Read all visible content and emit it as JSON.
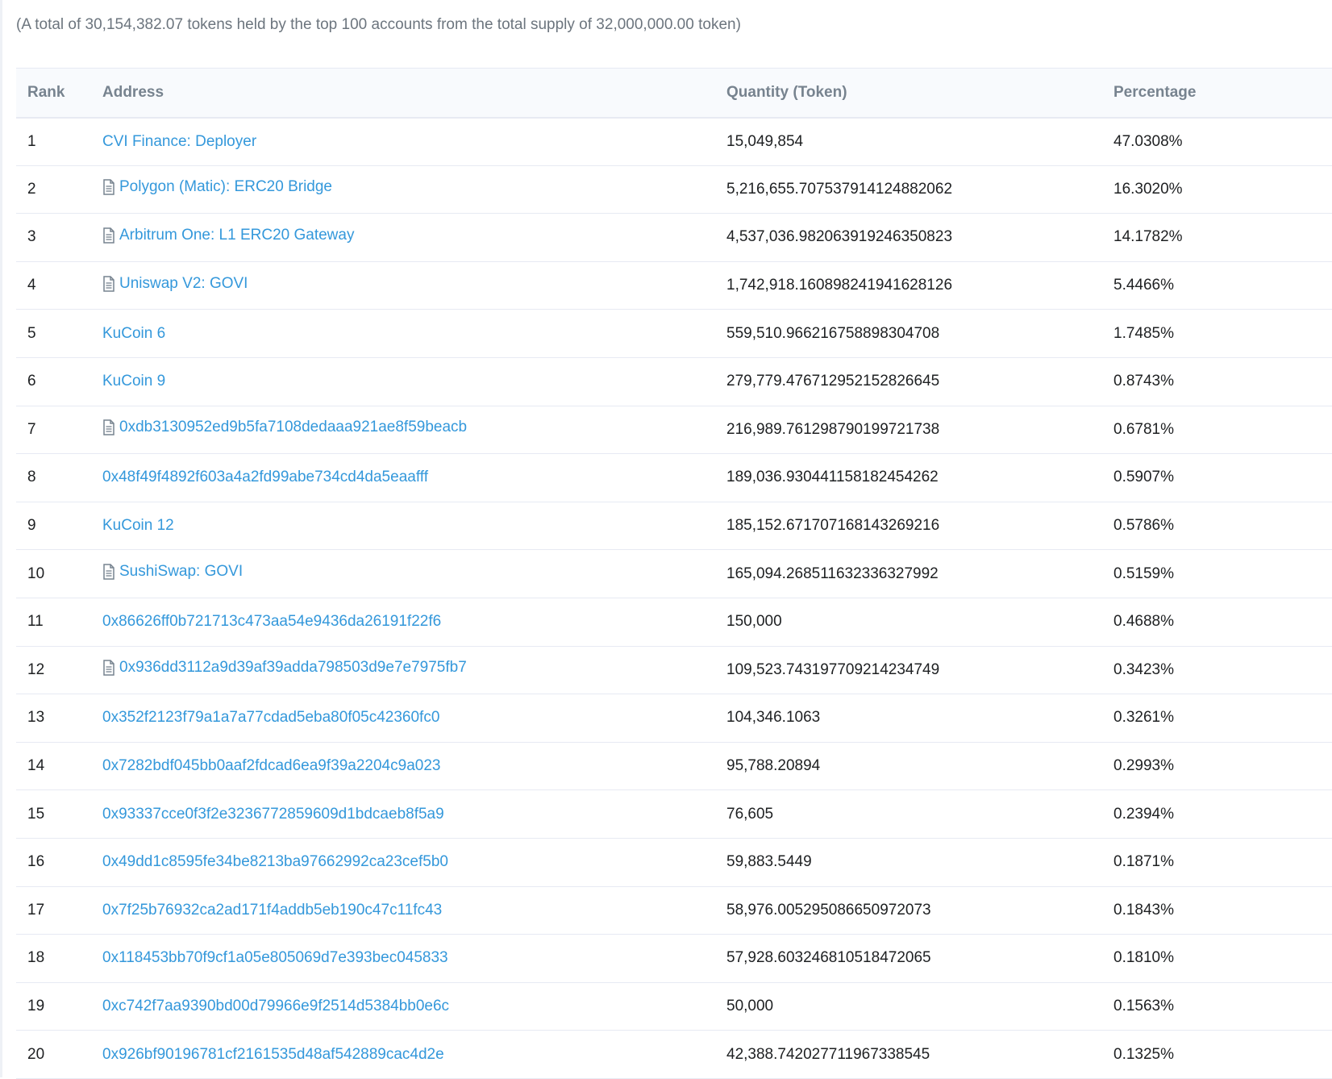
{
  "summary_text": "(A total of 30,154,382.07 tokens held by the top 100 accounts from the total supply of 32,000,000.00 token)",
  "table": {
    "headers": {
      "rank": "Rank",
      "address": "Address",
      "quantity": "Quantity (Token)",
      "percentage": "Percentage"
    },
    "rows": [
      {
        "rank": "1",
        "address": "CVI Finance: Deployer",
        "is_contract": false,
        "quantity": "15,049,854",
        "percentage": "47.0308%"
      },
      {
        "rank": "2",
        "address": "Polygon (Matic): ERC20 Bridge",
        "is_contract": true,
        "quantity": "5,216,655.707537914124882062",
        "percentage": "16.3020%"
      },
      {
        "rank": "3",
        "address": "Arbitrum One: L1 ERC20 Gateway",
        "is_contract": true,
        "quantity": "4,537,036.982063919246350823",
        "percentage": "14.1782%"
      },
      {
        "rank": "4",
        "address": "Uniswap V2: GOVI",
        "is_contract": true,
        "quantity": "1,742,918.160898241941628126",
        "percentage": "5.4466%"
      },
      {
        "rank": "5",
        "address": "KuCoin 6",
        "is_contract": false,
        "quantity": "559,510.966216758898304708",
        "percentage": "1.7485%"
      },
      {
        "rank": "6",
        "address": "KuCoin 9",
        "is_contract": false,
        "quantity": "279,779.476712952152826645",
        "percentage": "0.8743%"
      },
      {
        "rank": "7",
        "address": "0xdb3130952ed9b5fa7108dedaaa921ae8f59beacb",
        "is_contract": true,
        "quantity": "216,989.761298790199721738",
        "percentage": "0.6781%"
      },
      {
        "rank": "8",
        "address": "0x48f49f4892f603a4a2fd99abe734cd4da5eaafff",
        "is_contract": false,
        "quantity": "189,036.930441158182454262",
        "percentage": "0.5907%"
      },
      {
        "rank": "9",
        "address": "KuCoin 12",
        "is_contract": false,
        "quantity": "185,152.671707168143269216",
        "percentage": "0.5786%"
      },
      {
        "rank": "10",
        "address": "SushiSwap: GOVI",
        "is_contract": true,
        "quantity": "165,094.268511632336327992",
        "percentage": "0.5159%"
      },
      {
        "rank": "11",
        "address": "0x86626ff0b721713c473aa54e9436da26191f22f6",
        "is_contract": false,
        "quantity": "150,000",
        "percentage": "0.4688%"
      },
      {
        "rank": "12",
        "address": "0x936dd3112a9d39af39adda798503d9e7e7975fb7",
        "is_contract": true,
        "quantity": "109,523.743197709214234749",
        "percentage": "0.3423%"
      },
      {
        "rank": "13",
        "address": "0x352f2123f79a1a7a77cdad5eba80f05c42360fc0",
        "is_contract": false,
        "quantity": "104,346.1063",
        "percentage": "0.3261%"
      },
      {
        "rank": "14",
        "address": "0x7282bdf045bb0aaf2fdcad6ea9f39a2204c9a023",
        "is_contract": false,
        "quantity": "95,788.20894",
        "percentage": "0.2993%"
      },
      {
        "rank": "15",
        "address": "0x93337cce0f3f2e3236772859609d1bdcaeb8f5a9",
        "is_contract": false,
        "quantity": "76,605",
        "percentage": "0.2394%"
      },
      {
        "rank": "16",
        "address": "0x49dd1c8595fe34be8213ba97662992ca23cef5b0",
        "is_contract": false,
        "quantity": "59,883.5449",
        "percentage": "0.1871%"
      },
      {
        "rank": "17",
        "address": "0x7f25b76932ca2ad171f4addb5eb190c47c11fc43",
        "is_contract": false,
        "quantity": "58,976.005295086650972073",
        "percentage": "0.1843%"
      },
      {
        "rank": "18",
        "address": "0x118453bb70f9cf1a05e805069d7e393bec045833",
        "is_contract": false,
        "quantity": "57,928.603246810518472065",
        "percentage": "0.1810%"
      },
      {
        "rank": "19",
        "address": "0xc742f7aa9390bd00d79966e9f2514d5384bb0e6c",
        "is_contract": false,
        "quantity": "50,000",
        "percentage": "0.1563%"
      },
      {
        "rank": "20",
        "address": "0x926bf90196781cf2161535d48af542889cac4d2e",
        "is_contract": false,
        "quantity": "42,388.742027711967338545",
        "percentage": "0.1325%"
      }
    ]
  },
  "icons": {
    "contract": "contract-file-icon"
  },
  "colors": {
    "link": "#3498db",
    "header_text": "#77838f",
    "summary_text": "#6c757e",
    "border": "#e7eaf3"
  }
}
